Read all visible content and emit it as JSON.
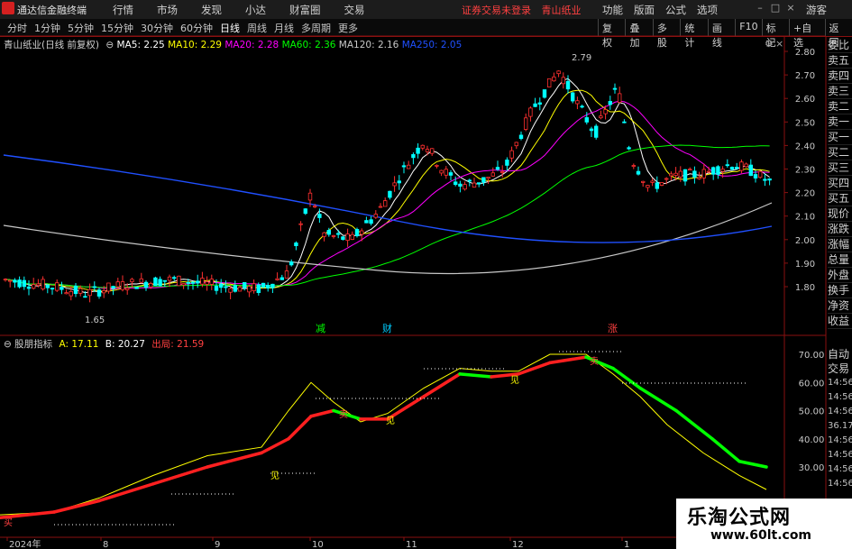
{
  "app": {
    "name": "通达信金融终端",
    "menu": [
      "行情",
      "市场",
      "发现",
      "小达",
      "财富圈",
      "交易"
    ],
    "notice": "证券交易未登录",
    "stock_title": "青山纸业",
    "right_menu": [
      "功能",
      "版面",
      "公式",
      "选项"
    ],
    "guest": "游客"
  },
  "toolbar": {
    "periods": [
      "分时",
      "1分钟",
      "5分钟",
      "15分钟",
      "30分钟",
      "60分钟",
      "日线",
      "周线",
      "月线",
      "多周期",
      "更多"
    ],
    "active_period": "日线",
    "tools": [
      "复权",
      "叠加",
      "多股",
      "统计",
      "画线",
      "F10",
      "标记",
      "+自选",
      "返回"
    ]
  },
  "main_chart": {
    "label": "青山纸业(日线 前复权)",
    "ma": [
      {
        "name": "MA5",
        "value": "2.25",
        "color": "#ffffff"
      },
      {
        "name": "MA10",
        "value": "2.29",
        "color": "#ffff00"
      },
      {
        "name": "MA20",
        "value": "2.28",
        "color": "#ff00ff"
      },
      {
        "name": "MA60",
        "value": "2.36",
        "color": "#00ff00"
      },
      {
        "name": "MA120",
        "value": "2.16",
        "color": "#c8c8c8"
      },
      {
        "name": "MA250",
        "value": "2.05",
        "color": "#2050ff"
      }
    ],
    "y_ticks": [
      "2.80",
      "2.70",
      "2.60",
      "2.50",
      "2.40",
      "2.30",
      "2.20",
      "2.10",
      "2.00",
      "1.90",
      "1.80"
    ],
    "high_label": "2.79",
    "low_label": "1.65",
    "markers": [
      {
        "text": "减",
        "color": "#00ff00"
      },
      {
        "text": "财",
        "color": "#00ccff"
      },
      {
        "text": "涨",
        "color": "#ff4040"
      }
    ]
  },
  "indicator": {
    "name": "股朋指标",
    "values": [
      {
        "label": "A: 17.11",
        "color": "#ffff00"
      },
      {
        "label": "B: 20.27",
        "color": "#ffffff"
      },
      {
        "label": "出局: 21.59",
        "color": "#ff4040"
      }
    ],
    "y_ticks": [
      "70.00",
      "60.00",
      "50.00",
      "40.00",
      "30.00"
    ],
    "signal_labels": [
      "买",
      "见",
      "加",
      "卖"
    ]
  },
  "x_axis": [
    "2024年",
    "8",
    "9",
    "10",
    "11",
    "12",
    "1"
  ],
  "right_col": [
    "委比",
    "卖五",
    "卖四",
    "卖三",
    "卖二",
    "卖一",
    "买一",
    "买二",
    "买三",
    "买四",
    "买五",
    "现价",
    "涨跌",
    "涨幅",
    "总量",
    "外盘",
    "换手",
    "净资",
    "收益"
  ],
  "right_col2": [
    "自动",
    "交易"
  ],
  "time_rows": [
    "14:56",
    "14:56",
    "14:56",
    "36.17",
    "14:56",
    "14:56",
    "14:56",
    "14:56"
  ],
  "watermark": {
    "line1": "乐淘公式网",
    "line2": "www.60lt.com"
  },
  "colors": {
    "up": "#ff3030",
    "down": "#00ffff",
    "panel_border": "#8a1010"
  }
}
